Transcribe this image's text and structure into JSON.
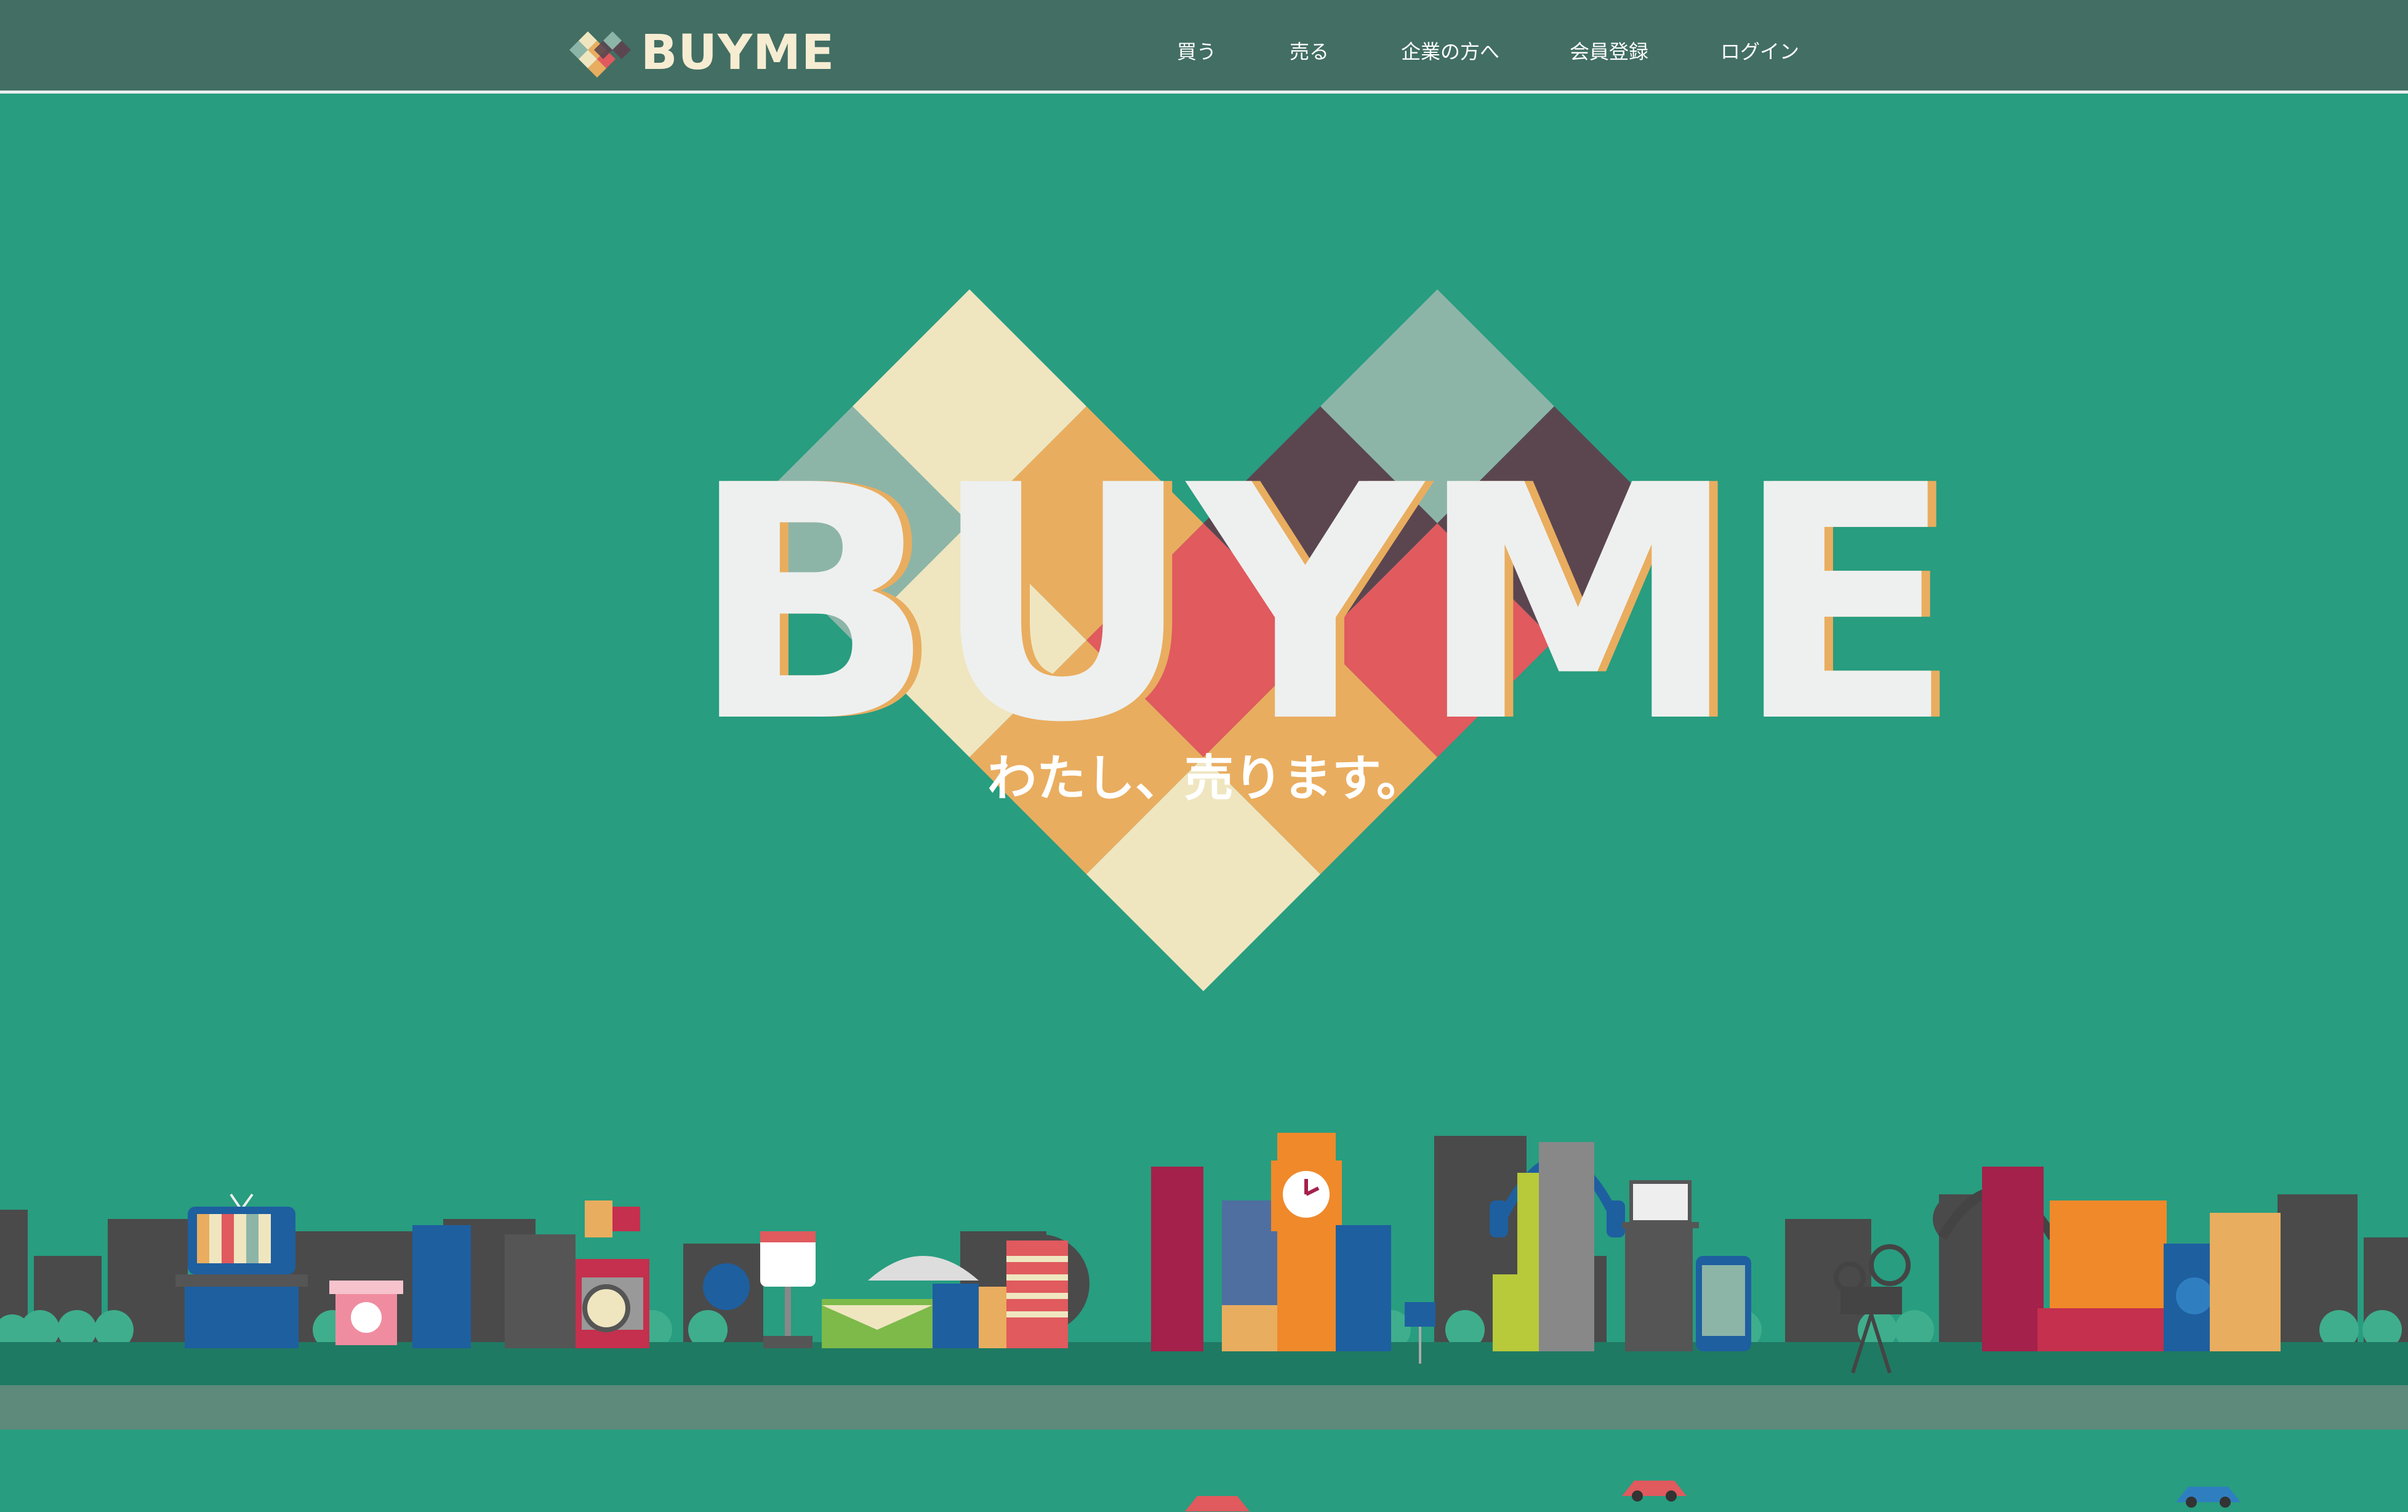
{
  "brand": {
    "name": "BUYME"
  },
  "nav": {
    "items": [
      {
        "label": "買う"
      },
      {
        "label": "売る"
      },
      {
        "label": "企業の方へ"
      },
      {
        "label": "会員登録"
      },
      {
        "label": "ログイン"
      }
    ]
  },
  "hero": {
    "title": "BUYME",
    "tagline": "わたし、売ります。"
  },
  "colors": {
    "background": "#289d80",
    "navbar": "#426e63",
    "brand_text": "#f6ecd2",
    "cream": "#efe6c0",
    "orange": "#e9ad5f",
    "coral": "#e05a5e",
    "plum": "#5b4650",
    "sage": "#8cb5a8",
    "road": "#5d8a7a",
    "ground": "#1f7a63"
  },
  "icons": [
    "heart-logo-icon",
    "tv-icon",
    "camera-icon",
    "clock-icon",
    "headphones-icon",
    "laptop-icon",
    "phone-icon",
    "film-projector-icon",
    "code-sign-icon",
    "power-icon",
    "car-icon"
  ]
}
